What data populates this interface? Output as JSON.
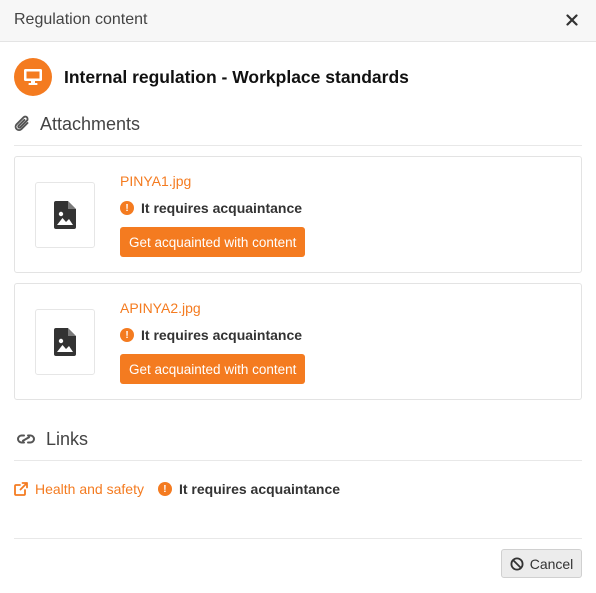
{
  "dialog": {
    "title": "Regulation content",
    "close_icon": "close-icon"
  },
  "regulation": {
    "title": "Internal regulation - Workplace standards",
    "icon": "monitor-icon",
    "accent_color": "#f47b20"
  },
  "attachments": {
    "heading": "Attachments",
    "icon": "paperclip-icon",
    "items": [
      {
        "file_name": "PINYA1.jpg",
        "status": "It requires acquaintance",
        "action_label": "Get acquainted with content",
        "thumb_icon": "image-file-icon"
      },
      {
        "file_name": "APINYA2.jpg",
        "status": "It requires acquaintance",
        "action_label": "Get acquainted with content",
        "thumb_icon": "image-file-icon"
      }
    ]
  },
  "links": {
    "heading": "Links",
    "icon": "link-icon",
    "items": [
      {
        "label": "Health and safety",
        "status": "It requires acquaintance",
        "icon": "external-link-icon"
      }
    ]
  },
  "footer": {
    "cancel_label": "Cancel",
    "cancel_icon": "ban-icon"
  }
}
